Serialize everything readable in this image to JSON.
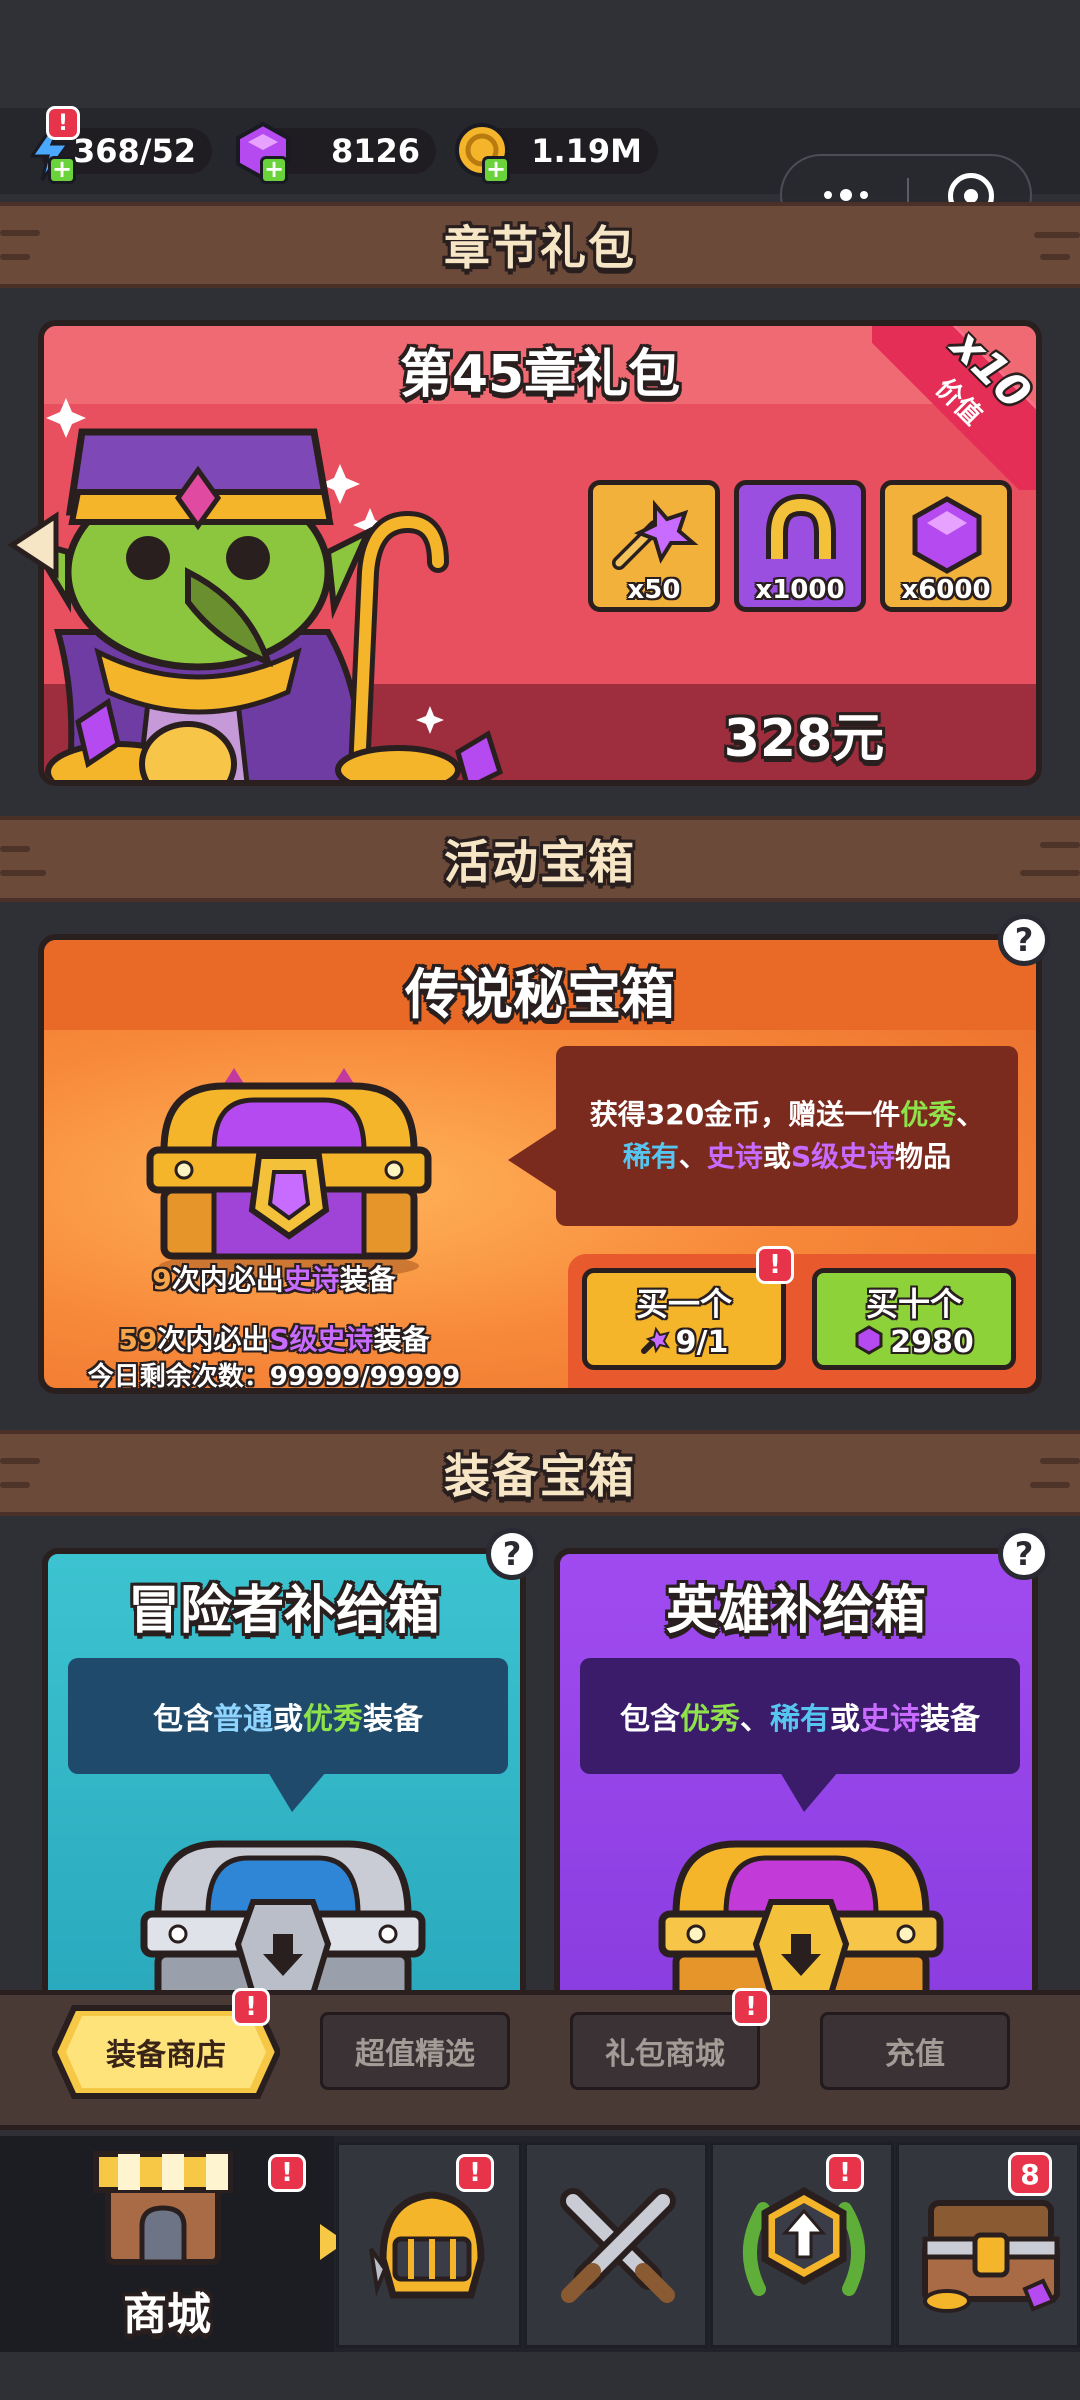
{
  "resources": {
    "energy": "368/52",
    "gems": "8126",
    "gold": "1.19M"
  },
  "sections": {
    "chapter_pack": "章节礼包",
    "event_chest": "活动宝箱",
    "equipment_chest": "装备宝箱"
  },
  "chapter_pack": {
    "title": "第45章礼包",
    "ribbon_multiplier": "x10",
    "ribbon_label": "价值",
    "items": [
      {
        "icon": "scepter-key-icon",
        "qty": "x50",
        "bg": "#f2b13b"
      },
      {
        "icon": "horseshoe-icon",
        "qty": "x1000",
        "bg": "#9b4fe0"
      },
      {
        "icon": "purple-gem-icon",
        "qty": "x6000",
        "bg": "#f2b13b"
      }
    ],
    "price": "328元"
  },
  "legend_chest": {
    "title": "传说秘宝箱",
    "desc_line1_a": "获得320金币，赠送一件",
    "desc_line1_b": "优秀",
    "desc_line1_c": "、",
    "desc_line2_a": "稀有",
    "desc_line2_b": "、",
    "desc_line2_c": "史诗",
    "desc_line2_d": "或",
    "desc_line2_e": "S级史诗",
    "desc_line2_f": "物品",
    "pity1_num": "9",
    "pity1_a": "次内必出",
    "pity1_b": "史诗",
    "pity1_c": "装备",
    "pity2_num": "59",
    "pity2_a": "次内必出",
    "pity2_b": "S级史诗",
    "pity2_c": "装备",
    "remaining": "今日剩余次数：99999/99999",
    "buy_one_label": "买一个",
    "buy_one_cost": "9/1",
    "buy_ten_label": "买十个",
    "buy_ten_cost": "2980"
  },
  "adventurer_box": {
    "title": "冒险者补给箱",
    "desc_a": "包含",
    "desc_b": "普通",
    "desc_c": "或",
    "desc_d": "优秀",
    "desc_e": "装备"
  },
  "hero_box": {
    "title": "英雄补给箱",
    "desc_a": "包含",
    "desc_b": "优秀",
    "desc_c": "、",
    "desc_d": "稀有",
    "desc_e": "或",
    "desc_f": "史诗",
    "desc_g": "装备"
  },
  "shop_tabs": [
    "装备商店",
    "超值精选",
    "礼包商城",
    "充值"
  ],
  "nav": {
    "shop_label": "商城",
    "chest_badge": "8"
  },
  "colors": {
    "excellent": "#8fe34a",
    "rare": "#56c6f0",
    "epic": "#c86bff",
    "s_epic": "#c86bff",
    "pity_num": "#f6a54a",
    "normal": "#8fd3ff"
  }
}
